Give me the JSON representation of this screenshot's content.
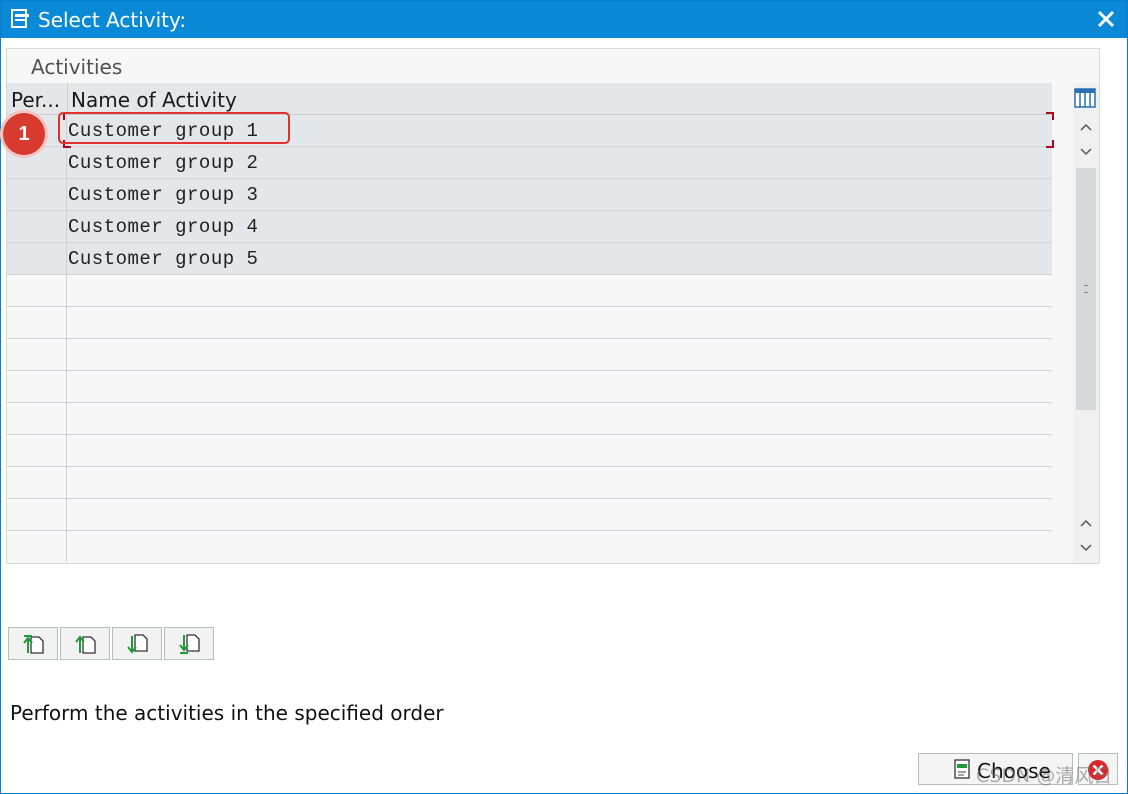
{
  "window": {
    "title": "Select Activity:",
    "accent_color": "#0a8ad6",
    "title_icon": "dialog-icon",
    "close_icon": "close-icon"
  },
  "panel": {
    "title": "Activities",
    "columns": [
      "Per...",
      "Name of Activity"
    ],
    "rows": [
      {
        "per": "",
        "name": "Customer group 1"
      },
      {
        "per": "",
        "name": "Customer group 2"
      },
      {
        "per": "",
        "name": "Customer group 3"
      },
      {
        "per": "",
        "name": "Customer group 4"
      },
      {
        "per": "",
        "name": "Customer group 5"
      }
    ],
    "empty_row_count": 9,
    "highlight_color": "#e0312b"
  },
  "annotation": {
    "step": "1"
  },
  "toolbar": {
    "icons": [
      "move-to-top-icon",
      "move-up-icon",
      "move-down-icon",
      "move-to-bottom-icon"
    ]
  },
  "message": "Perform the activities in the specified order",
  "buttons": {
    "choose_label": "Choose",
    "choose_icon": "choose-icon",
    "cancel_icon": "cancel-icon"
  },
  "watermark": "CSDN @清风日下"
}
